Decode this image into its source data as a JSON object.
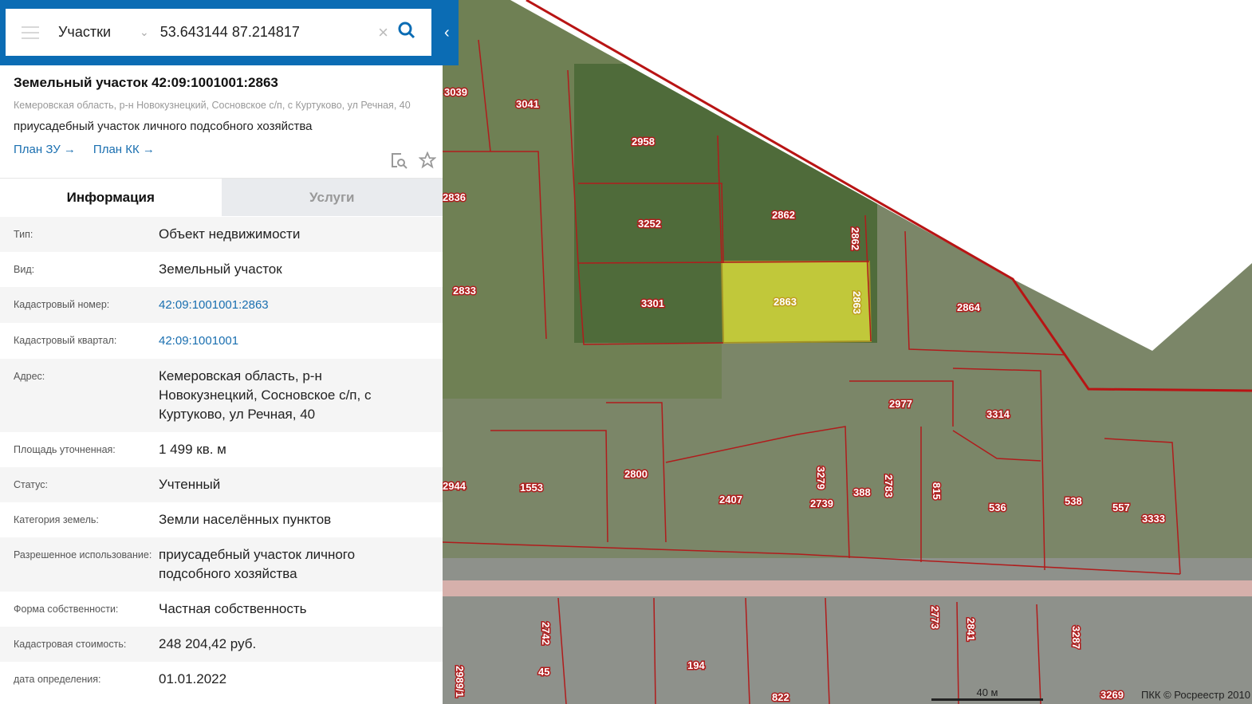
{
  "search": {
    "layer": "Участки",
    "query": "53.643144 87.214817"
  },
  "object": {
    "title": "Земельный участок 42:09:1001001:2863",
    "address": "Кемеровская область, р-н Новокузнецкий, Сосновское с/п, с Куртуково, ул Речная, 40",
    "use": "приусадебный участок личного подсобного хозяйства",
    "link_zu": "План ЗУ →",
    "link_kk": "План КК →"
  },
  "tabs": [
    {
      "label": "Информация"
    },
    {
      "label": "Услуги"
    }
  ],
  "rows": [
    {
      "label": "Тип:",
      "value": "Объект недвижимости"
    },
    {
      "label": "Вид:",
      "value": "Земельный участок"
    },
    {
      "label": "Кадастровый номер:",
      "value": "42:09:1001001:2863"
    },
    {
      "label": "Кадастровый квартал:",
      "value": "42:09:1001001"
    },
    {
      "label": "Адрес:",
      "value": "Кемеровская область, р-н Новокузнецкий, Сосновское с/п, с Куртуково, ул Речная, 40"
    },
    {
      "label": "Площадь уточненная:",
      "value": "1 499 кв. м"
    },
    {
      "label": "Статус:",
      "value": "Учтенный"
    },
    {
      "label": "Категория земель:",
      "value": "Земли населённых пунктов"
    },
    {
      "label": "Разрешенное использование:",
      "value": "приусадебный участок личного подсобного хозяйства"
    },
    {
      "label": "Форма собственности:",
      "value": "Частная собственность"
    },
    {
      "label": "Кадастровая стоимость:",
      "value": "248 204,42 руб."
    },
    {
      "label": "дата определения:",
      "value": "01.01.2022"
    }
  ],
  "map": {
    "scale": "40 м",
    "copyright": "ПКК © Росреестр 2010",
    "highlight": "#e8e83a",
    "parcels": [
      "3039",
      "3041",
      "2958",
      "2836",
      "3252",
      "2862",
      "2862",
      "2833",
      "3301",
      "2863",
      "2863",
      "2864",
      "2977",
      "3314",
      "2944",
      "1553",
      "2800",
      "2407",
      "3279",
      "2739",
      "388",
      "2783",
      "815",
      "536",
      "538",
      "557",
      "3333",
      "2742",
      "2989/1",
      "45",
      "194",
      "822",
      "2773",
      "2841",
      "3287",
      "3269"
    ]
  }
}
